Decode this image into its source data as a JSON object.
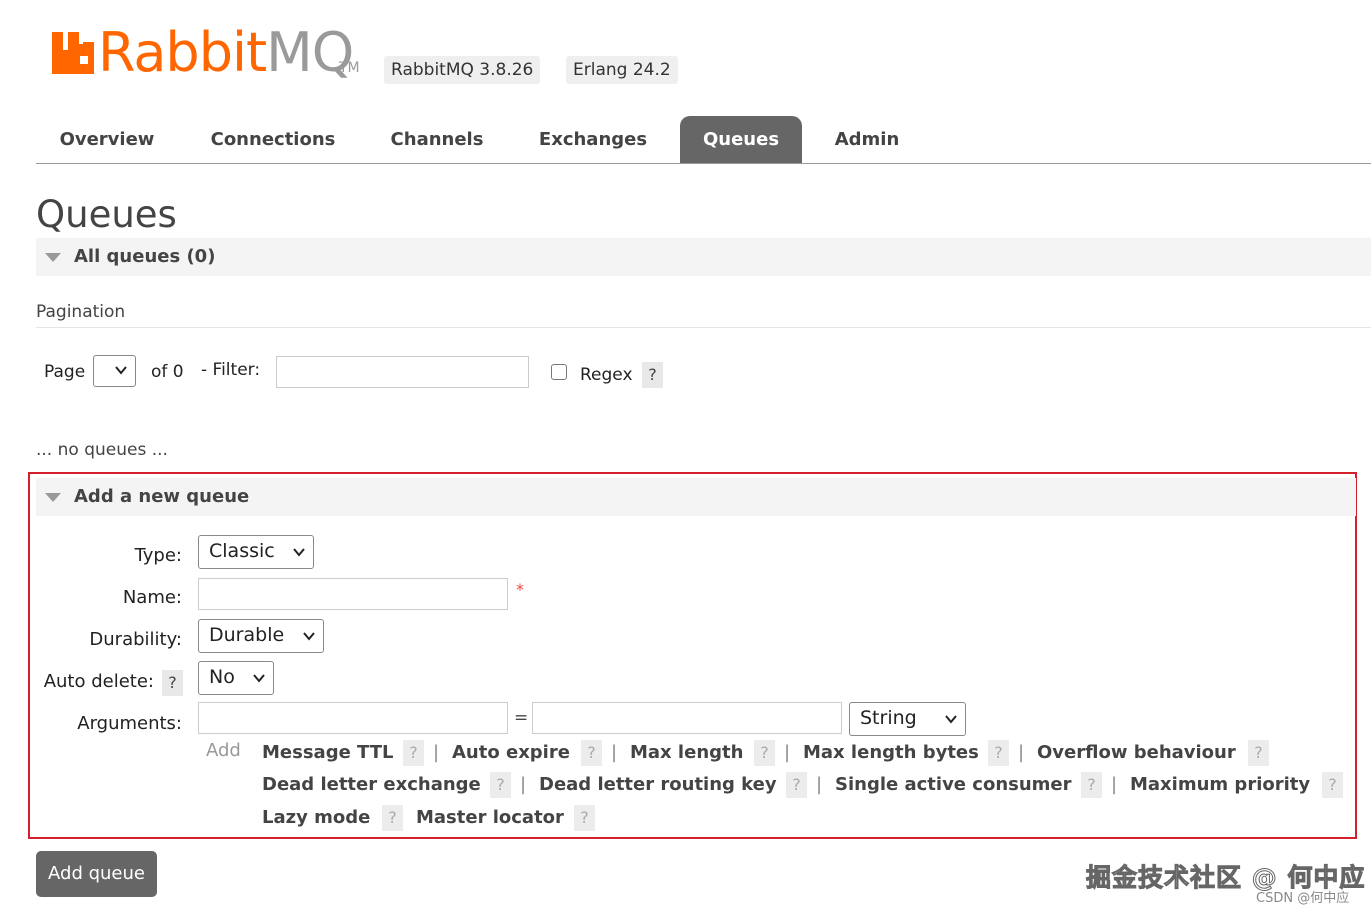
{
  "header": {
    "logo_text_rabbit": "Rabbit",
    "logo_text_mq": "MQ",
    "logo_tm": "TM",
    "version_badge": "RabbitMQ 3.8.26",
    "erlang_badge": "Erlang 24.2",
    "brand_color": "#ff6600"
  },
  "nav": {
    "tabs": [
      {
        "label": "Overview"
      },
      {
        "label": "Connections"
      },
      {
        "label": "Channels"
      },
      {
        "label": "Exchanges"
      },
      {
        "label": "Queues",
        "active": true
      },
      {
        "label": "Admin"
      }
    ]
  },
  "page": {
    "title": "Queues",
    "all_queues_label": "All queues (0)",
    "pagination_label": "Pagination",
    "page_label": "Page",
    "page_of": "of 0",
    "filter_label": "- Filter:",
    "filter_value": "",
    "regex_label": "Regex",
    "regex_checked": false,
    "help_label": "?",
    "no_queues": "... no queues ..."
  },
  "add_queue": {
    "section_title": "Add a new queue",
    "type_label": "Type:",
    "type_value": "Classic",
    "name_label": "Name:",
    "name_value": "",
    "required_mark": "*",
    "durability_label": "Durability:",
    "durability_value": "Durable",
    "auto_delete_label": "Auto delete:",
    "auto_delete_value": "No",
    "arguments_label": "Arguments:",
    "args_equals": "=",
    "args_type_value": "String",
    "add_label": "Add",
    "argument_links": [
      "Message TTL",
      "Auto expire",
      "Max length",
      "Max length bytes",
      "Overflow behaviour",
      "Dead letter exchange",
      "Dead letter routing key",
      "Single active consumer",
      "Maximum priority",
      "Lazy mode",
      "Master locator"
    ],
    "separator": "|",
    "submit_label": "Add queue",
    "highlight_color": "#d4202c"
  },
  "watermark": {
    "main": "掘金技术社区 @ 何中应",
    "sub": "CSDN @何中应"
  }
}
